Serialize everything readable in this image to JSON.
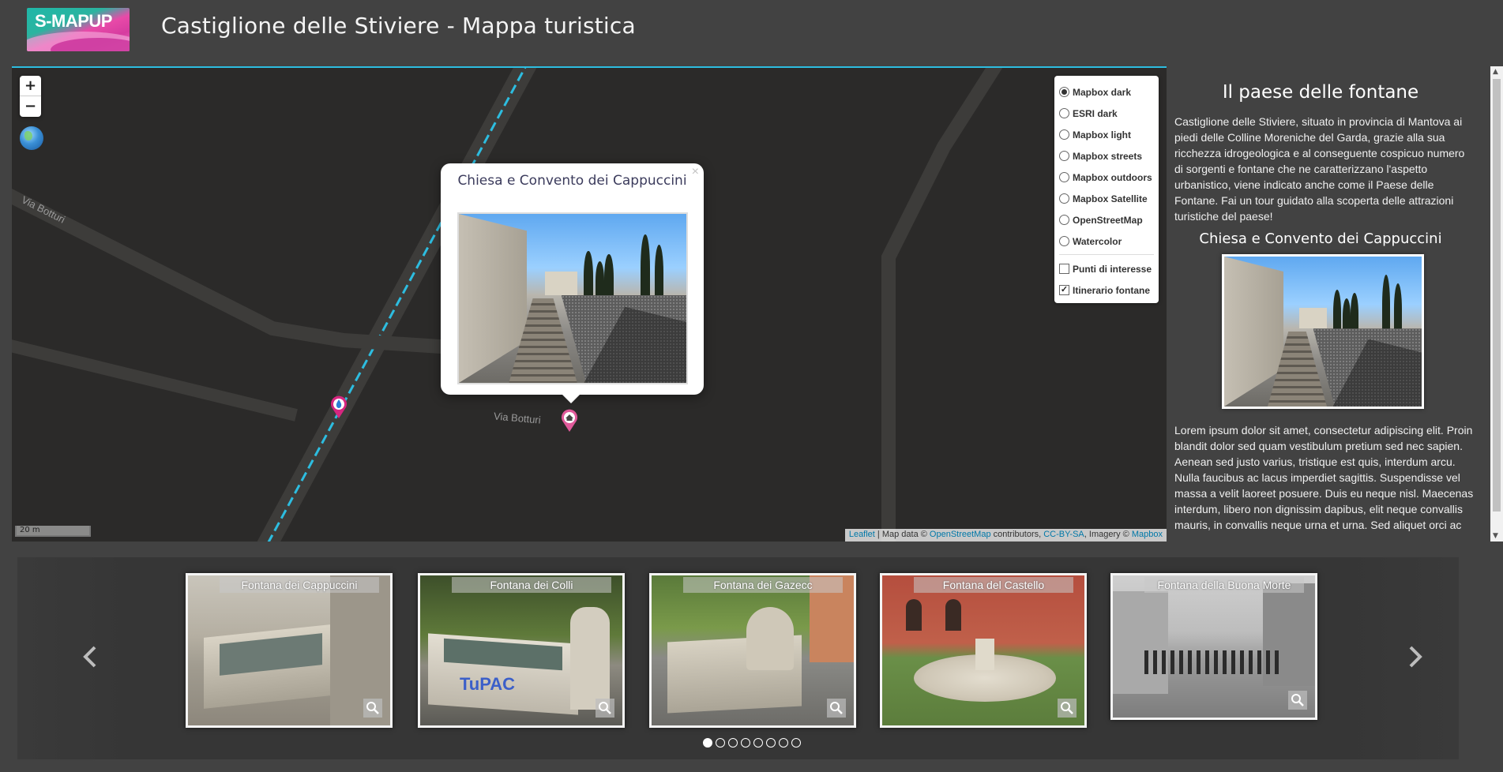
{
  "header": {
    "logo_text_left": "S-MAP",
    "logo_text_right": "UP",
    "title": "Castiglione delle Stiviere - Mappa turistica"
  },
  "map": {
    "zoom_in": "+",
    "zoom_out": "−",
    "scale_label": "20 m",
    "road_label_1": "Via Botturi",
    "road_label_2": "Via Botturi",
    "attribution": {
      "leaflet": "Leaflet",
      "text1": " | Map data © ",
      "osm": "OpenStreetMap",
      "text2": " contributors, ",
      "license": "CC-BY-SA",
      "text3": ", Imagery © ",
      "mapbox": "Mapbox"
    },
    "accent_color": "#2dbde0",
    "marker_color": "#d6267f"
  },
  "layers": {
    "base": [
      {
        "label": "Mapbox dark",
        "selected": true
      },
      {
        "label": "ESRI dark",
        "selected": false
      },
      {
        "label": "Mapbox light",
        "selected": false
      },
      {
        "label": "Mapbox streets",
        "selected": false
      },
      {
        "label": "Mapbox outdoors",
        "selected": false
      },
      {
        "label": "Mapbox Satellite",
        "selected": false
      },
      {
        "label": "OpenStreetMap",
        "selected": false
      },
      {
        "label": "Watercolor",
        "selected": false
      }
    ],
    "overlays": [
      {
        "label": "Punti di interesse",
        "checked": false
      },
      {
        "label": "Itinerario fontane",
        "checked": true
      }
    ]
  },
  "popup": {
    "close": "×",
    "title": "Chiesa e Convento dei Cappuccini"
  },
  "sidebar": {
    "title": "Il paese delle fontane",
    "intro": "Castiglione delle Stiviere, situato in provincia di Mantova ai piedi delle Colline Moreniche del Garda, grazie alla sua ricchezza idrogeologica e al conseguente cospicuo numero di sorgenti e fontane che ne caratterizzano l'aspetto urbanistico, viene indicato anche come il Paese delle Fontane. Fai un tour guidato alla scoperta delle attrazioni turistiche del paese!",
    "subtitle": "Chiesa e Convento dei Cappuccini",
    "lorem": "Lorem ipsum dolor sit amet, consectetur adipiscing elit. Proin blandit dolor sed quam vestibulum pretium sed nec sapien. Aenean sed justo varius, tristique est quis, interdum arcu. Nulla faucibus ac lacus imperdiet sagittis. Suspendisse vel massa a velit laoreet posuere. Duis eu neque nisl. Maecenas interdum, libero non dignissim dapibus, elit neque convallis mauris, in convallis neque urna et urna. Sed aliquet orci ac"
  },
  "carousel": {
    "cards": [
      {
        "caption": "Fontana dei Cappuccini"
      },
      {
        "caption": "Fontana dei Colli"
      },
      {
        "caption": "Fontana dei Gazecc"
      },
      {
        "caption": "Fontana del Castello"
      },
      {
        "caption": "Fontana della Buona Morte"
      }
    ],
    "pages": 8,
    "active_page": 1
  }
}
